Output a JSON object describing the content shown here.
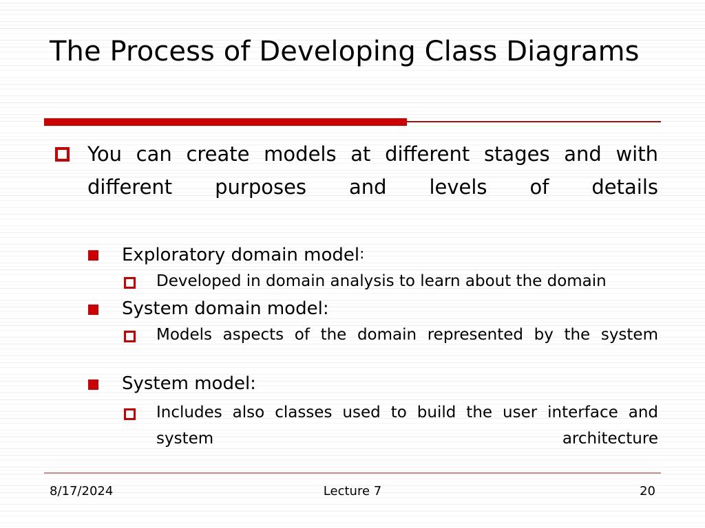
{
  "slide": {
    "title": "The Process of Developing  Class Diagrams",
    "accent_color": "#cc0000",
    "accent_thin_color": "#9c1111",
    "footer_rule_color": "#c98c8c",
    "text_color": "#000000",
    "background_color": "#ffffff"
  },
  "content": {
    "level1": {
      "marker": "hollow-square-red",
      "text": "You can create models at different stages and with different purposes and levels of details"
    },
    "items": [
      {
        "marker": "filled-square-red",
        "heading": "Exploratory domain model",
        "heading_colon": ":",
        "sub": {
          "marker": "hollow-square-red",
          "text": "Developed in domain analysis to learn about the domain"
        }
      },
      {
        "marker": "filled-square-red",
        "heading": "System domain model:",
        "heading_colon": "",
        "sub": {
          "marker": "hollow-square-red",
          "text": "Models aspects of the domain represented by the system"
        }
      },
      {
        "marker": "filled-square-red",
        "heading": "System model:",
        "heading_colon": "",
        "sub": {
          "marker": "hollow-square-red",
          "text": "Includes also classes used to build the user interface and system architecture"
        }
      }
    ]
  },
  "footer": {
    "date": "8/17/2024",
    "center": "Lecture 7",
    "page_number": "20"
  }
}
